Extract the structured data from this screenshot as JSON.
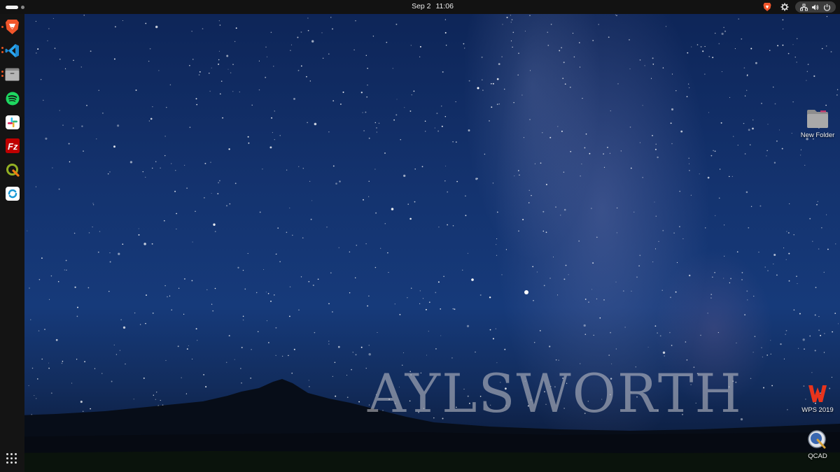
{
  "top_bar": {
    "date": "Sep 2",
    "time": "11:06"
  },
  "dock": {
    "apps": [
      {
        "name": "brave-browser-icon",
        "running": true
      },
      {
        "name": "vscode-icon",
        "running": true
      },
      {
        "name": "files-icon",
        "running": true
      },
      {
        "name": "spotify-icon",
        "running": false
      },
      {
        "name": "slack-icon",
        "running": false
      },
      {
        "name": "filezilla-icon",
        "running": false
      },
      {
        "name": "qgis-icon",
        "running": false
      },
      {
        "name": "remote-desktop-icon",
        "running": false
      }
    ],
    "show_apps_icon": "grid-icon"
  },
  "desktop": {
    "icons": [
      {
        "label": "New Folder",
        "icon": "folder-icon"
      },
      {
        "label": "WPS 2019",
        "icon": "wps-icon"
      },
      {
        "label": "QCAD",
        "icon": "qcad-icon"
      }
    ],
    "watermark": "AYLSWORTH"
  },
  "colors": {
    "accent": "#e95420",
    "panel": "#121212",
    "sky_top": "#0d2456",
    "sky_mid": "#163a7a"
  }
}
